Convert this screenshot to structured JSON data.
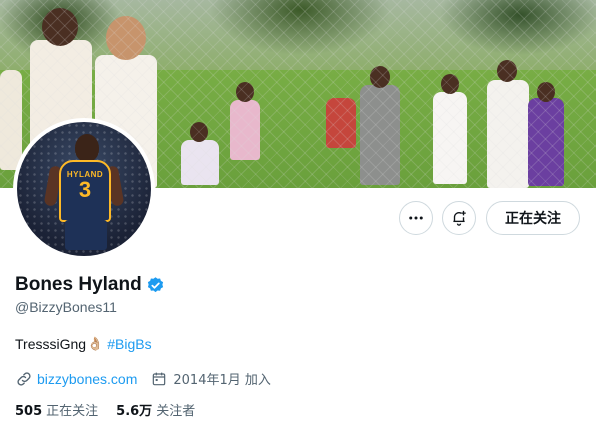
{
  "profile": {
    "name": "Bones Hyland",
    "handle": "@BizzyBones11",
    "bio_text": "TresssiGng",
    "bio_emoji": "👌🏼",
    "bio_hashtag": "#BigBs",
    "website": "bizzybones.com",
    "joined": "2014年1月 加入",
    "following_count": "505",
    "following_label": "正在关注",
    "followers_count": "5.6万",
    "followers_label": "关注者"
  },
  "avatar": {
    "jersey_name": "HYLAND",
    "jersey_number": "3"
  },
  "actions": {
    "follow_label": "正在关注"
  },
  "icons": {
    "more": "more-horizontal-icon",
    "notify": "bell-plus-icon",
    "verified": "verified-badge-icon",
    "link": "link-icon",
    "calendar": "calendar-icon"
  },
  "colors": {
    "accent": "#1d9bf0",
    "text": "#0f1419",
    "muted": "#536471",
    "border": "#cfd9de"
  }
}
